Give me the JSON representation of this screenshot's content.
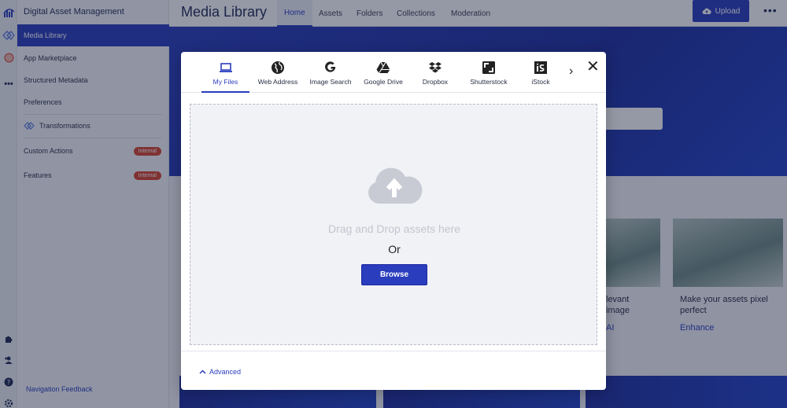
{
  "app": {
    "title": "Digital Asset Management"
  },
  "sidebar": {
    "items": [
      {
        "label": "Media Library",
        "active": true
      },
      {
        "label": "App Marketplace"
      },
      {
        "label": "Structured Metadata"
      },
      {
        "label": "Preferences"
      },
      {
        "label": "Transformations"
      },
      {
        "label": "Custom Actions",
        "badge": "Internal"
      },
      {
        "label": "Features",
        "badge": "Internal"
      }
    ],
    "feedback": "Navigation Feedback"
  },
  "header": {
    "title": "Media Library",
    "tabs": [
      {
        "label": "Home",
        "active": true
      },
      {
        "label": "Assets"
      },
      {
        "label": "Folders"
      },
      {
        "label": "Collections"
      },
      {
        "label": "Moderation"
      }
    ],
    "upload_label": "Upload",
    "more_label": "•••"
  },
  "background": {
    "card1_text_line1": "levant",
    "card1_text_line2": "image",
    "card1_link": "AI",
    "card2_text_line1": "Make your assets pixel",
    "card2_text_line2": "perfect",
    "card2_link": "Enhance"
  },
  "upload_dialog": {
    "sources": [
      {
        "label": "My Files",
        "icon": "laptop-icon",
        "active": true
      },
      {
        "label": "Web Address",
        "icon": "globe-icon"
      },
      {
        "label": "Image Search",
        "icon": "google-icon"
      },
      {
        "label": "Google Drive",
        "icon": "google-drive-icon"
      },
      {
        "label": "Dropbox",
        "icon": "dropbox-icon"
      },
      {
        "label": "Shutterstock",
        "icon": "shutterstock-icon"
      },
      {
        "label": "iStock",
        "icon": "istock-icon"
      }
    ],
    "drop_text": "Drag and Drop assets here",
    "or_text": "Or",
    "browse_label": "Browse",
    "advanced_label": "Advanced"
  },
  "colors": {
    "accent": "#2a3dbd",
    "badge": "#d9442e"
  }
}
